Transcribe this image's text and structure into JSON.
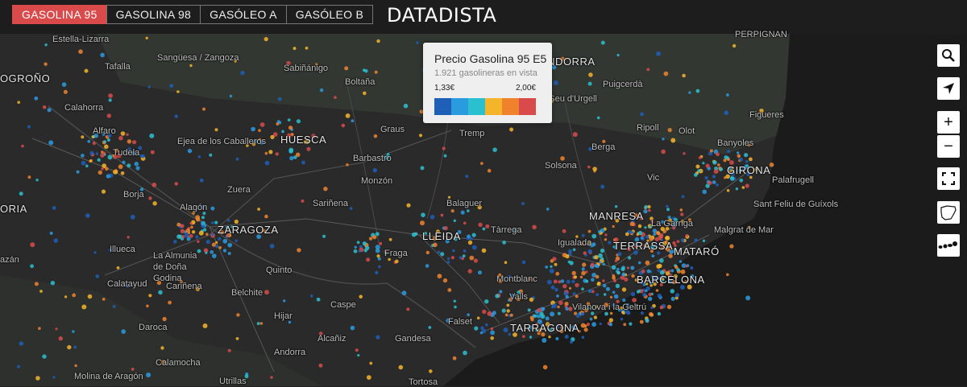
{
  "tabs": [
    {
      "label": "GASOLINA 95",
      "active": true
    },
    {
      "label": "GASOLINA 98",
      "active": false
    },
    {
      "label": "GASÓLEO A",
      "active": false
    },
    {
      "label": "GASÓLEO B",
      "active": false
    }
  ],
  "brand": "DATADISTA",
  "legend": {
    "title": "Precio Gasolina 95 E5",
    "count": "1.921 gasolineras en vista",
    "min": "1,33€",
    "max": "2,00€",
    "colors": [
      "#1f5fb8",
      "#2b9be0",
      "#2bc0d0",
      "#f5b52a",
      "#f0822e",
      "#d94b4b"
    ]
  },
  "controls": [
    {
      "name": "search-icon",
      "glyph": "⌕"
    },
    {
      "name": "locate-icon",
      "glyph": "➤"
    },
    {
      "name": "zoom-in-button",
      "glyph": "+"
    },
    {
      "name": "zoom-out-button",
      "glyph": "−"
    },
    {
      "name": "fullscreen-icon",
      "glyph": "⛶"
    },
    {
      "name": "spain-map-icon",
      "glyph": ""
    },
    {
      "name": "islands-map-icon",
      "glyph": ""
    }
  ],
  "places": [
    "Estella-Lizarra",
    "Sangüesa / Zangoza",
    "Sabiñánigo",
    "Boltaña",
    "ANDORRA",
    "Puigcerdà",
    "PERPIGNAN",
    "OGROÑO",
    "Tafalla",
    "Calahorra",
    "Alfaro",
    "Tudela",
    "Ejea de los Caballeros",
    "HUESCA",
    "Graus",
    "Tremp",
    "Ripoll",
    "Olot",
    "La Seu d'Urgell",
    "Berga",
    "Figueres",
    "Banyoles",
    "GIRONA",
    "Palafrugell",
    "Barbastro",
    "Solsona",
    "Vic",
    "Monzón",
    "Zuera",
    "Borja",
    "Sariñena",
    "Balaguer",
    "MANRESA",
    "ORIA",
    "Alagón",
    "ZARAGOZA",
    "LLEIDA",
    "Tàrrega",
    "La Garriga",
    "Malgrat de Mar",
    "Sant Feliu de Guíxols",
    "Igualada",
    "TERRASSA",
    "MATARÓ",
    "Illueca",
    "La Almunia de Doña Godina",
    "Fraga",
    "Quinto",
    "BARCELONA",
    "azán",
    "Calatayud",
    "Cariñena",
    "Belchite",
    "Montblanc",
    "Valls",
    "Vilanova i la Geltrú",
    "Caspe",
    "Hijar",
    "Falset",
    "TARRAGONA",
    "Daroca",
    "Alcañiz",
    "Gandesa",
    "Andorra",
    "Calamocha",
    "Molina de Aragón",
    "Utrillas",
    "Tortosa"
  ]
}
